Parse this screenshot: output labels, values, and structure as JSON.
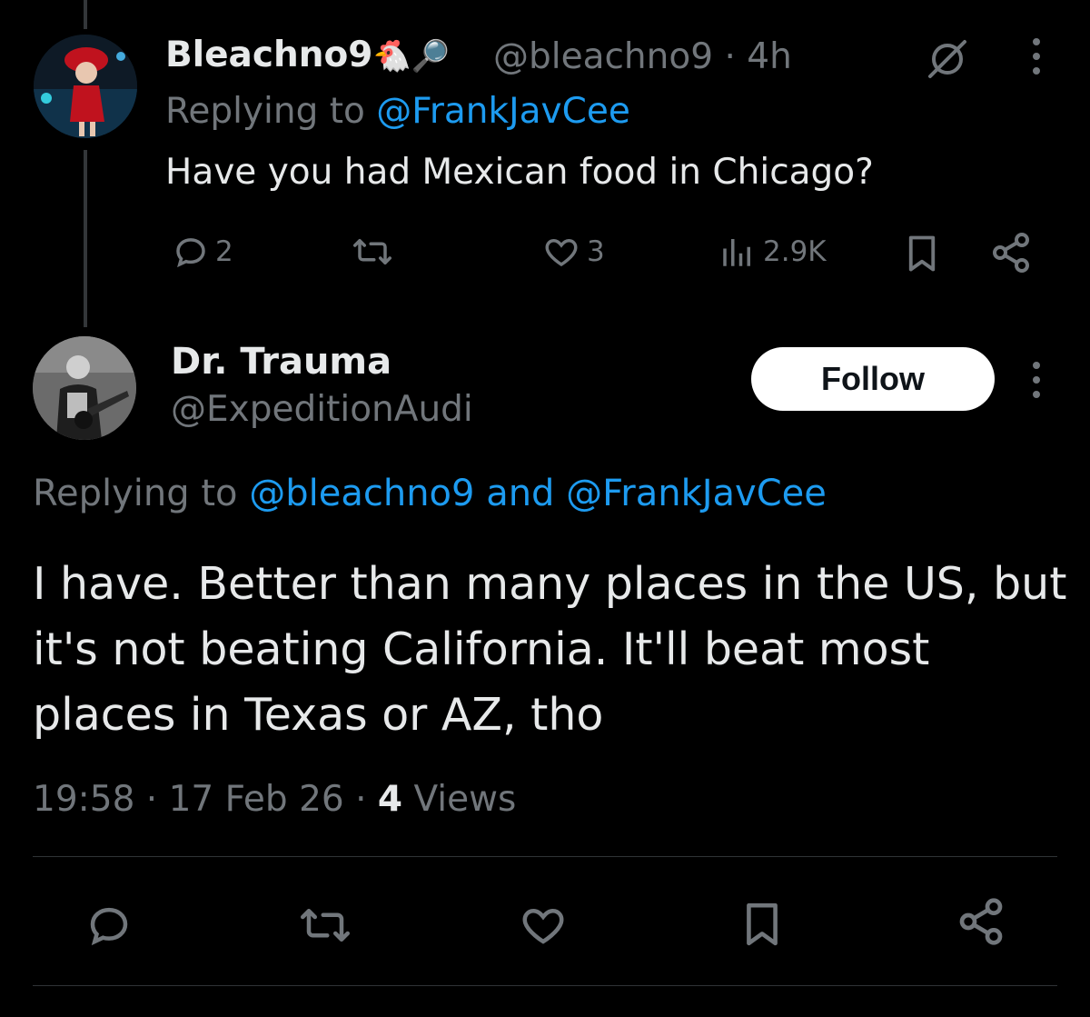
{
  "parent_tweet": {
    "display_name": "Bleachno9",
    "name_emojis": "🐔🔎",
    "handle": "@bleachno9",
    "time": "4h",
    "replying_prefix": "Replying to",
    "replying_to": "@FrankJavCee",
    "text": "Have you had Mexican food in Chicago?",
    "replies": "2",
    "likes": "3",
    "views": "2.9K"
  },
  "main_tweet": {
    "display_name": "Dr. Trauma",
    "handle": "@ExpeditionAudi",
    "follow_label": "Follow",
    "replying_prefix": "Replying to",
    "replying_to": "@bleachno9 and @FrankJavCee",
    "text": "I have. Better than many places in the US, but it's not beating California. It'll beat most places in Texas or AZ, tho",
    "time": "19:58",
    "date": "17 Feb 26",
    "views_count": "4",
    "views_label": "Views"
  },
  "icons": {
    "reply": "reply-icon",
    "retweet": "retweet-icon",
    "like": "heart-icon",
    "views": "views-icon",
    "bookmark": "bookmark-icon",
    "share": "share-icon",
    "grok": "grok-icon",
    "more": "more-icon"
  },
  "colors": {
    "accent": "#1d9bf0",
    "muted": "#71767b",
    "text": "#e7e9ea",
    "background": "#000000"
  }
}
